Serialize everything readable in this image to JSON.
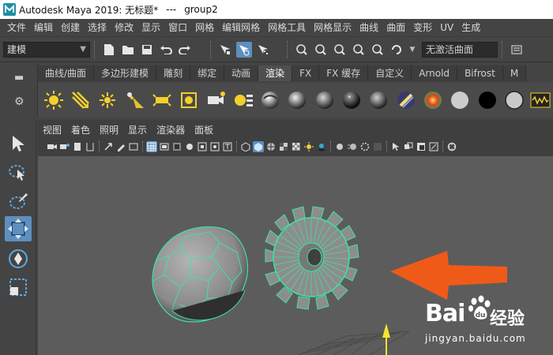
{
  "window": {
    "title": "Autodesk Maya 2019: 无标题*",
    "separator": "---",
    "selection": "group2"
  },
  "menubar": {
    "items": [
      "文件",
      "编辑",
      "创建",
      "选择",
      "修改",
      "显示",
      "窗口",
      "网格",
      "编辑网格",
      "网格工具",
      "网格显示",
      "曲线",
      "曲面",
      "变形",
      "UV",
      "生成"
    ]
  },
  "status_line": {
    "mode_dropdown": "建模",
    "live_surface": "无激活曲面"
  },
  "shelf": {
    "tabs": [
      "曲线/曲面",
      "多边形建模",
      "雕刻",
      "绑定",
      "动画",
      "渲染",
      "FX",
      "FX 缓存",
      "自定义",
      "Arnold",
      "Bifrost",
      "M"
    ],
    "active_tab": "渲染"
  },
  "panel": {
    "menu": [
      "视图",
      "着色",
      "照明",
      "显示",
      "渲染器",
      "面板"
    ]
  },
  "watermark": {
    "brand": "Bai",
    "brand_suffix": "经验",
    "url": "jingyan.baidu.com"
  },
  "colors": {
    "accent_blue": "#5d8fbf",
    "wireframe_green": "#3fe3a0",
    "arrow_orange": "#f05a19",
    "viewport_bg": "#5c5c5c"
  }
}
